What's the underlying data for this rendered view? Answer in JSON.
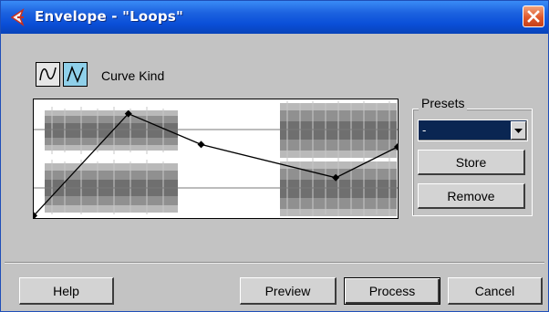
{
  "window": {
    "title": "Envelope - \"Loops\""
  },
  "toolbar": {
    "curve_kind_label": "Curve Kind",
    "curve_buttons": [
      {
        "name": "spline",
        "icon": "spline-curve-icon",
        "active": false
      },
      {
        "name": "linear",
        "icon": "linear-curve-icon",
        "active": true
      }
    ]
  },
  "presets": {
    "group_label": "Presets",
    "selected": "-",
    "store_label": "Store",
    "remove_label": "Remove"
  },
  "footer": {
    "help_label": "Help",
    "preview_label": "Preview",
    "process_label": "Process",
    "cancel_label": "Cancel"
  },
  "envelope": {
    "points": [
      {
        "x": 0.0,
        "y": 0.02
      },
      {
        "x": 0.26,
        "y": 0.88
      },
      {
        "x": 0.46,
        "y": 0.62
      },
      {
        "x": 0.83,
        "y": 0.34
      },
      {
        "x": 1.0,
        "y": 0.6
      }
    ]
  },
  "colors": {
    "titlebar": "#0a4fd8",
    "waveform": "#909090",
    "waveform_dark": "#6f6f6f",
    "preset_bg": "#0a2652",
    "curve_active": "#8fd0ea"
  }
}
